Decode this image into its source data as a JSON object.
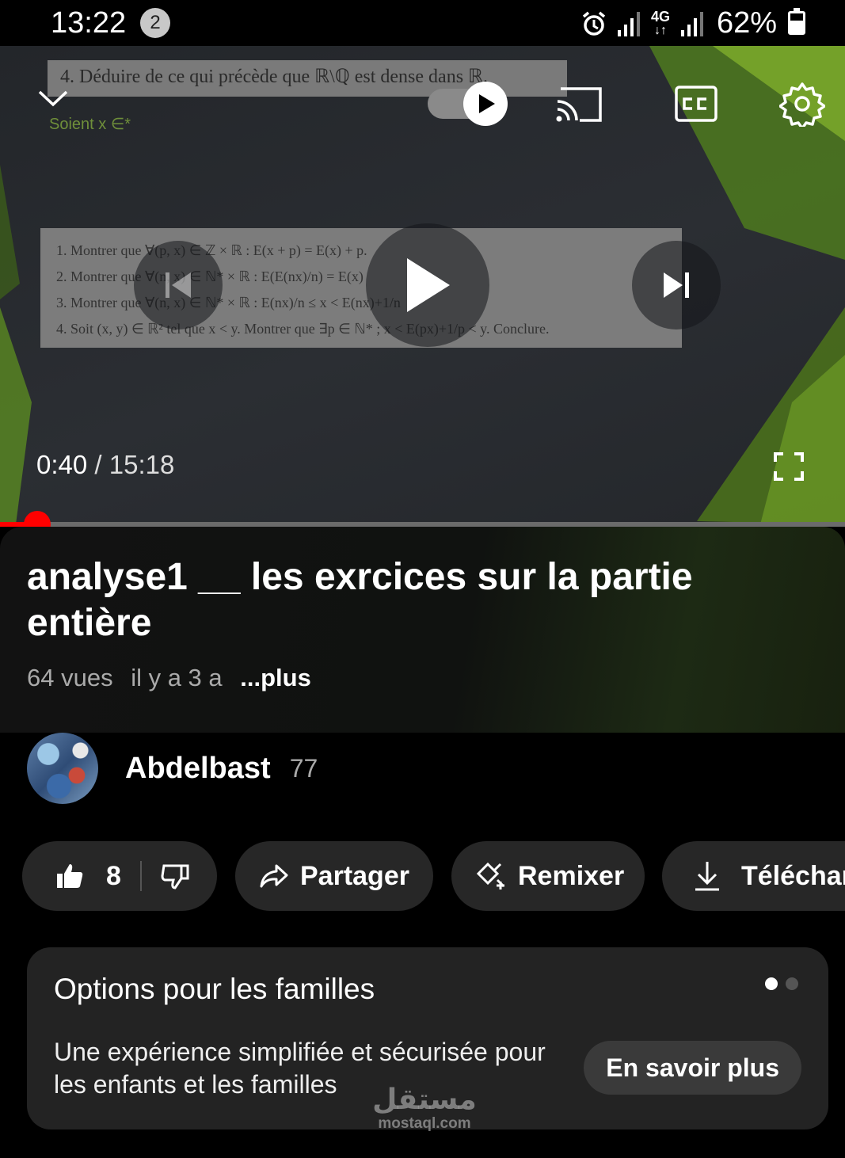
{
  "status_bar": {
    "time": "13:22",
    "notification_count": "2",
    "network": "4G",
    "battery": "62%"
  },
  "player": {
    "slide": {
      "heading": "4. Déduire de ce qui précède que ℝ\\ℚ est dense dans ℝ.",
      "soient": "Soient  x ∈*",
      "lines": [
        "1. Montrer que ∀(p, x) ∈ ℤ × ℝ :      E(x + p) = E(x) + p.",
        "2. Montrer que ∀(n, x) ∈ ℕ* × ℝ :     E(E(nx)/n) = E(x)",
        "3. Montrer que ∀(n, x) ∈ ℕ* × ℝ :     E(nx)/n ≤ x < E(nx)+1/n",
        "4. Soit (x, y) ∈ ℝ² tel que x < y. Montrer que ∃p ∈ ℕ* ; x < E(px)+1/p < y. Conclure."
      ]
    },
    "current_time": "0:40",
    "separator": "/",
    "duration": "15:18",
    "progress_fraction": 0.044,
    "icons": [
      "chevron-down-icon",
      "autoplay-toggle",
      "cast-icon",
      "captions-icon",
      "settings-icon",
      "previous-icon",
      "play-icon",
      "next-icon",
      "fullscreen-icon"
    ]
  },
  "video": {
    "title": "analyse1 __ les exrcices sur la partie entière",
    "views": "64 vues",
    "age": "il y a 3 a",
    "more": "...plus"
  },
  "channel": {
    "name": "Abdelbast",
    "subscribers": "77"
  },
  "actions": {
    "likes": "8",
    "share": "Partager",
    "remix": "Remixer",
    "download": "Téléchar"
  },
  "family_card": {
    "title": "Options pour les familles",
    "description": "Une expérience simplifiée et sécurisée pour les enfants et les familles",
    "button": "En savoir plus"
  },
  "watermark": {
    "arabic": "مستقل",
    "domain": "mostaql.com"
  },
  "colors": {
    "progress": "#ff0000",
    "chip_bg": "#272727",
    "card_bg": "#232323",
    "accent_green": "#6f9a24"
  }
}
